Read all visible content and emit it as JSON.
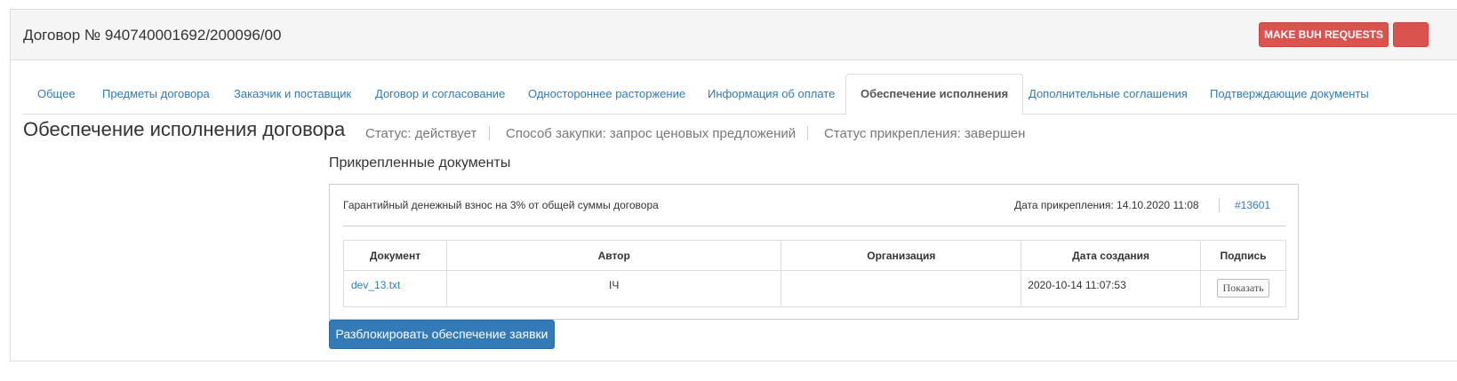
{
  "header": {
    "title": "Договор № 940740001692/200096/00",
    "make_buh_requests": "MAKE BUH REQUESTS"
  },
  "tabs": [
    {
      "label": "Общее",
      "active": false
    },
    {
      "label": "Предметы договора",
      "active": false
    },
    {
      "label": "Заказчик и поставщик",
      "active": false
    },
    {
      "label": "Договор и согласование",
      "active": false
    },
    {
      "label": "Одностороннее расторжение",
      "active": false
    },
    {
      "label": "Информация об оплате",
      "active": false
    },
    {
      "label": "Обеспечение исполнения",
      "active": true
    },
    {
      "label": "Дополнительные соглашения",
      "active": false
    },
    {
      "label": "Подтверждающие документы",
      "active": false
    }
  ],
  "section": {
    "title": "Обеспечение исполнения договора",
    "status": "Статус: действует",
    "procurement_method": "Способ закупки: запрос ценовых предложений",
    "attachment_status": "Статус прикрепления: завершен"
  },
  "attached": {
    "title": "Прикрепленные документы",
    "description": "Гарантийный денежный взнос на 3% от общей суммы договора",
    "date": "Дата прикрепления: 14.10.2020 11:08",
    "id": "#13601",
    "columns": [
      "Документ",
      "Автор",
      "Организация",
      "Дата создания",
      "Подпись"
    ],
    "rows": [
      {
        "document": "dev_13.txt",
        "author": "ІЧ",
        "organization": "",
        "created": "2020-10-14 11:07:53",
        "sign_button": "Показать"
      }
    ]
  },
  "unlock_button": "Разблокировать обеспечение заявки",
  "colors": {
    "danger": "#d9534f",
    "primary": "#337ab7",
    "link": "#337ab7"
  }
}
